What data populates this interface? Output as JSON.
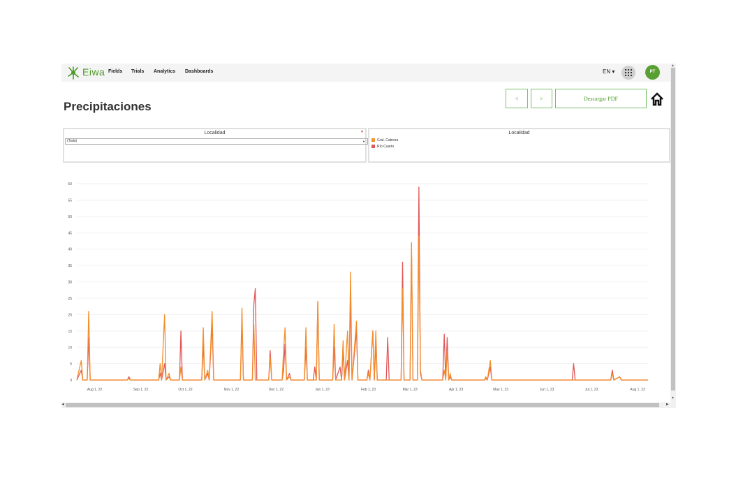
{
  "nav": {
    "brand": "Eiwa",
    "links": [
      "Fields",
      "Trials",
      "Analytics",
      "Dashboards"
    ],
    "language": "EN ▾",
    "avatar_initials": "PT"
  },
  "page": {
    "title": "Precipitaciones",
    "prev_label": "<",
    "next_label": ">",
    "download_label": "Descargar PDF"
  },
  "filter": {
    "title": "Localidad",
    "selected": "(Todo)"
  },
  "legend": {
    "title": "Localidad",
    "items": [
      {
        "label": "Gral. Cabrera",
        "color": "#f28e2b"
      },
      {
        "label": "Río Cuarto",
        "color": "#e15759"
      }
    ]
  },
  "chart_data": {
    "type": "line",
    "x_ticks": [
      "Aug 1, 22",
      "Sep 1, 22",
      "Oct 1, 22",
      "Nov 1, 22",
      "Dec 1, 22",
      "Jan 1, 23",
      "Feb 1, 23",
      "Mar 1, 23",
      "Apr 1, 23",
      "May 1, 23",
      "Jun 1, 23",
      "Jul 1, 23",
      "Aug 1, 23"
    ],
    "y_ticks": [
      0,
      5,
      10,
      15,
      20,
      25,
      30,
      35,
      40,
      45,
      50,
      55,
      60
    ],
    "ylim": [
      0,
      60
    ],
    "xlim": [
      "2022-07-20",
      "2023-08-08"
    ],
    "grid": true,
    "series": [
      {
        "name": "Gral. Cabrera",
        "color": "#f28e2b",
        "points": [
          [
            "2022-07-20",
            0
          ],
          [
            "2022-07-23",
            6
          ],
          [
            "2022-07-24",
            0
          ],
          [
            "2022-07-27",
            0
          ],
          [
            "2022-07-28",
            21
          ],
          [
            "2022-07-29",
            0
          ],
          [
            "2022-08-23",
            0
          ],
          [
            "2022-08-24",
            0.5
          ],
          [
            "2022-08-25",
            0
          ],
          [
            "2022-09-13",
            0
          ],
          [
            "2022-09-14",
            5
          ],
          [
            "2022-09-15",
            0
          ],
          [
            "2022-09-17",
            20
          ],
          [
            "2022-09-18",
            0
          ],
          [
            "2022-09-20",
            2
          ],
          [
            "2022-09-21",
            0
          ],
          [
            "2022-09-27",
            0
          ],
          [
            "2022-09-28",
            4
          ],
          [
            "2022-09-29",
            0
          ],
          [
            "2022-10-12",
            0
          ],
          [
            "2022-10-13",
            16
          ],
          [
            "2022-10-14",
            0
          ],
          [
            "2022-10-16",
            3
          ],
          [
            "2022-10-17",
            0
          ],
          [
            "2022-10-19",
            21
          ],
          [
            "2022-10-20",
            0
          ],
          [
            "2022-11-07",
            0
          ],
          [
            "2022-11-08",
            22
          ],
          [
            "2022-11-09",
            0
          ],
          [
            "2022-11-15",
            0
          ],
          [
            "2022-11-16",
            17
          ],
          [
            "2022-11-17",
            0
          ],
          [
            "2022-11-26",
            0
          ],
          [
            "2022-11-27",
            7
          ],
          [
            "2022-11-28",
            0
          ],
          [
            "2022-12-05",
            0
          ],
          [
            "2022-12-06",
            9
          ],
          [
            "2022-12-07",
            16
          ],
          [
            "2022-12-08",
            0
          ],
          [
            "2022-12-10",
            1
          ],
          [
            "2022-12-11",
            0
          ],
          [
            "2022-12-20",
            0
          ],
          [
            "2022-12-21",
            16
          ],
          [
            "2022-12-22",
            0
          ],
          [
            "2022-12-28",
            0
          ],
          [
            "2022-12-29",
            24
          ],
          [
            "2022-12-30",
            0
          ],
          [
            "2023-01-08",
            0
          ],
          [
            "2023-01-09",
            17
          ],
          [
            "2023-01-10",
            0
          ],
          [
            "2023-01-14",
            0
          ],
          [
            "2023-01-15",
            12
          ],
          [
            "2023-01-16",
            0
          ],
          [
            "2023-01-18",
            15
          ],
          [
            "2023-01-19",
            0
          ],
          [
            "2023-01-20",
            33
          ],
          [
            "2023-01-21",
            0
          ],
          [
            "2023-01-24",
            18
          ],
          [
            "2023-01-25",
            0
          ],
          [
            "2023-01-31",
            0
          ],
          [
            "2023-02-01",
            2
          ],
          [
            "2023-02-02",
            0
          ],
          [
            "2023-02-04",
            15
          ],
          [
            "2023-02-05",
            0
          ],
          [
            "2023-02-06",
            15
          ],
          [
            "2023-02-07",
            0
          ],
          [
            "2023-02-23",
            0
          ],
          [
            "2023-02-24",
            28
          ],
          [
            "2023-02-25",
            0
          ],
          [
            "2023-03-01",
            0
          ],
          [
            "2023-03-02",
            42
          ],
          [
            "2023-03-03",
            0
          ],
          [
            "2023-03-06",
            0
          ],
          [
            "2023-03-07",
            44
          ],
          [
            "2023-03-08",
            3
          ],
          [
            "2023-03-09",
            0
          ],
          [
            "2023-03-23",
            0
          ],
          [
            "2023-03-24",
            3
          ],
          [
            "2023-03-25",
            0
          ],
          [
            "2023-03-26",
            9
          ],
          [
            "2023-03-27",
            0
          ],
          [
            "2023-03-28",
            2
          ],
          [
            "2023-03-29",
            0
          ],
          [
            "2023-04-20",
            0
          ],
          [
            "2023-04-21",
            1
          ],
          [
            "2023-04-22",
            0
          ],
          [
            "2023-04-24",
            6
          ],
          [
            "2023-04-25",
            0
          ],
          [
            "2023-07-14",
            0
          ],
          [
            "2023-07-15",
            2
          ],
          [
            "2023-07-16",
            0
          ],
          [
            "2023-07-20",
            1
          ],
          [
            "2023-07-21",
            0
          ],
          [
            "2023-08-08",
            0
          ]
        ]
      },
      {
        "name": "Río Cuarto",
        "color": "#e15759",
        "points": [
          [
            "2022-07-20",
            0
          ],
          [
            "2022-07-23",
            3
          ],
          [
            "2022-07-24",
            0
          ],
          [
            "2022-07-27",
            0
          ],
          [
            "2022-07-28",
            13
          ],
          [
            "2022-07-29",
            0
          ],
          [
            "2022-08-23",
            0
          ],
          [
            "2022-08-24",
            1
          ],
          [
            "2022-08-25",
            0
          ],
          [
            "2022-09-13",
            0
          ],
          [
            "2022-09-14",
            2
          ],
          [
            "2022-09-15",
            0
          ],
          [
            "2022-09-17",
            5
          ],
          [
            "2022-09-18",
            0
          ],
          [
            "2022-09-20",
            1
          ],
          [
            "2022-09-21",
            0
          ],
          [
            "2022-09-27",
            0
          ],
          [
            "2022-09-28",
            15
          ],
          [
            "2022-09-29",
            0
          ],
          [
            "2022-10-12",
            0
          ],
          [
            "2022-10-13",
            11
          ],
          [
            "2022-10-14",
            0
          ],
          [
            "2022-10-16",
            2
          ],
          [
            "2022-10-17",
            0
          ],
          [
            "2022-10-19",
            17
          ],
          [
            "2022-10-20",
            0
          ],
          [
            "2022-11-07",
            0
          ],
          [
            "2022-11-08",
            18
          ],
          [
            "2022-11-09",
            0
          ],
          [
            "2022-11-15",
            0
          ],
          [
            "2022-11-16",
            23
          ],
          [
            "2022-11-17",
            28
          ],
          [
            "2022-11-18",
            0
          ],
          [
            "2022-11-26",
            0
          ],
          [
            "2022-11-27",
            9
          ],
          [
            "2022-11-28",
            0
          ],
          [
            "2022-12-05",
            0
          ],
          [
            "2022-12-06",
            3
          ],
          [
            "2022-12-07",
            11
          ],
          [
            "2022-12-08",
            0
          ],
          [
            "2022-12-10",
            2
          ],
          [
            "2022-12-11",
            0
          ],
          [
            "2022-12-20",
            0
          ],
          [
            "2022-12-21",
            10
          ],
          [
            "2022-12-22",
            0
          ],
          [
            "2022-12-26",
            0
          ],
          [
            "2022-12-27",
            4
          ],
          [
            "2022-12-28",
            0
          ],
          [
            "2022-12-29",
            24
          ],
          [
            "2022-12-30",
            0
          ],
          [
            "2023-01-08",
            0
          ],
          [
            "2023-01-09",
            10
          ],
          [
            "2023-01-10",
            0
          ],
          [
            "2023-01-13",
            4
          ],
          [
            "2023-01-14",
            0
          ],
          [
            "2023-01-15",
            9
          ],
          [
            "2023-01-16",
            0
          ],
          [
            "2023-01-18",
            6
          ],
          [
            "2023-01-19",
            0
          ],
          [
            "2023-01-20",
            25
          ],
          [
            "2023-01-21",
            0
          ],
          [
            "2023-01-24",
            15
          ],
          [
            "2023-01-25",
            0
          ],
          [
            "2023-01-31",
            0
          ],
          [
            "2023-02-01",
            3
          ],
          [
            "2023-02-02",
            0
          ],
          [
            "2023-02-04",
            15
          ],
          [
            "2023-02-05",
            0
          ],
          [
            "2023-02-06",
            11
          ],
          [
            "2023-02-07",
            0
          ],
          [
            "2023-02-13",
            0
          ],
          [
            "2023-02-14",
            13
          ],
          [
            "2023-02-15",
            0
          ],
          [
            "2023-02-23",
            0
          ],
          [
            "2023-02-24",
            36
          ],
          [
            "2023-02-25",
            0
          ],
          [
            "2023-03-01",
            0
          ],
          [
            "2023-03-02",
            40
          ],
          [
            "2023-03-03",
            0
          ],
          [
            "2023-03-06",
            0
          ],
          [
            "2023-03-07",
            59
          ],
          [
            "2023-03-08",
            2
          ],
          [
            "2023-03-09",
            0
          ],
          [
            "2023-03-23",
            0
          ],
          [
            "2023-03-24",
            14
          ],
          [
            "2023-03-25",
            0
          ],
          [
            "2023-03-26",
            13
          ],
          [
            "2023-03-27",
            0
          ],
          [
            "2023-03-28",
            1
          ],
          [
            "2023-03-29",
            0
          ],
          [
            "2023-04-20",
            0
          ],
          [
            "2023-04-21",
            0.5
          ],
          [
            "2023-04-22",
            0
          ],
          [
            "2023-04-24",
            4
          ],
          [
            "2023-04-25",
            0
          ],
          [
            "2023-06-18",
            0
          ],
          [
            "2023-06-19",
            5
          ],
          [
            "2023-06-20",
            0
          ],
          [
            "2023-07-14",
            0
          ],
          [
            "2023-07-15",
            3
          ],
          [
            "2023-07-16",
            0
          ],
          [
            "2023-07-20",
            1
          ],
          [
            "2023-07-21",
            0
          ],
          [
            "2023-08-08",
            0
          ]
        ]
      }
    ]
  }
}
